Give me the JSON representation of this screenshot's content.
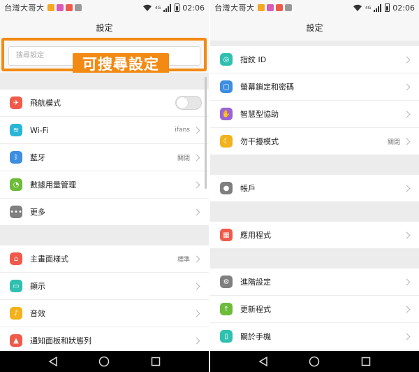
{
  "status": {
    "carrier": "台灣大哥大",
    "network": "4G",
    "time": "02:06"
  },
  "left": {
    "header_title": "設定",
    "search_placeholder": "搜尋設定",
    "callout": "可搜尋設定",
    "items": [
      {
        "label": "飛航模式",
        "value": "",
        "icon": "airplane-icon",
        "color": "#f05a4a",
        "toggle": true
      },
      {
        "label": "Wi-Fi",
        "value": "ifans",
        "icon": "wifi-icon",
        "color": "#29b6d6"
      },
      {
        "label": "藍牙",
        "value": "關閉",
        "icon": "bluetooth-icon",
        "color": "#3d8de0"
      },
      {
        "label": "數據用量管理",
        "value": "",
        "icon": "data-usage-icon",
        "color": "#6cbc3a"
      },
      {
        "label": "更多",
        "value": "",
        "icon": "more-icon",
        "color": "#7f7f7f"
      },
      {
        "label": "主畫面樣式",
        "value": "標準",
        "icon": "home-icon",
        "color": "#f05a4a"
      },
      {
        "label": "顯示",
        "value": "",
        "icon": "display-icon",
        "color": "#2fc0b0"
      },
      {
        "label": "音效",
        "value": "",
        "icon": "sound-icon",
        "color": "#f2b21c"
      },
      {
        "label": "通知面板和狀態列",
        "value": "",
        "icon": "notification-icon",
        "color": "#f05a4a"
      }
    ]
  },
  "right": {
    "header_title": "設定",
    "items": [
      {
        "label": "指紋 ID",
        "value": "",
        "icon": "fingerprint-icon",
        "color": "#2fc0b0"
      },
      {
        "label": "螢幕鎖定和密碼",
        "value": "",
        "icon": "lock-icon",
        "color": "#3d8de0"
      },
      {
        "label": "智慧型協助",
        "value": "",
        "icon": "hand-icon",
        "color": "#9a63d6"
      },
      {
        "label": "勿干擾模式",
        "value": "關閉",
        "icon": "moon-icon",
        "color": "#f2b21c"
      },
      {
        "label": "帳戶",
        "value": "",
        "icon": "account-icon",
        "color": "#7f7f7f"
      },
      {
        "label": "應用程式",
        "value": "",
        "icon": "apps-icon",
        "color": "#f05a4a"
      },
      {
        "label": "進階設定",
        "value": "",
        "icon": "gear-icon",
        "color": "#7f7f7f"
      },
      {
        "label": "更新程式",
        "value": "",
        "icon": "update-icon",
        "color": "#6cbc3a"
      },
      {
        "label": "關於手機",
        "value": "",
        "icon": "phone-icon",
        "color": "#2fc0b0"
      }
    ]
  }
}
